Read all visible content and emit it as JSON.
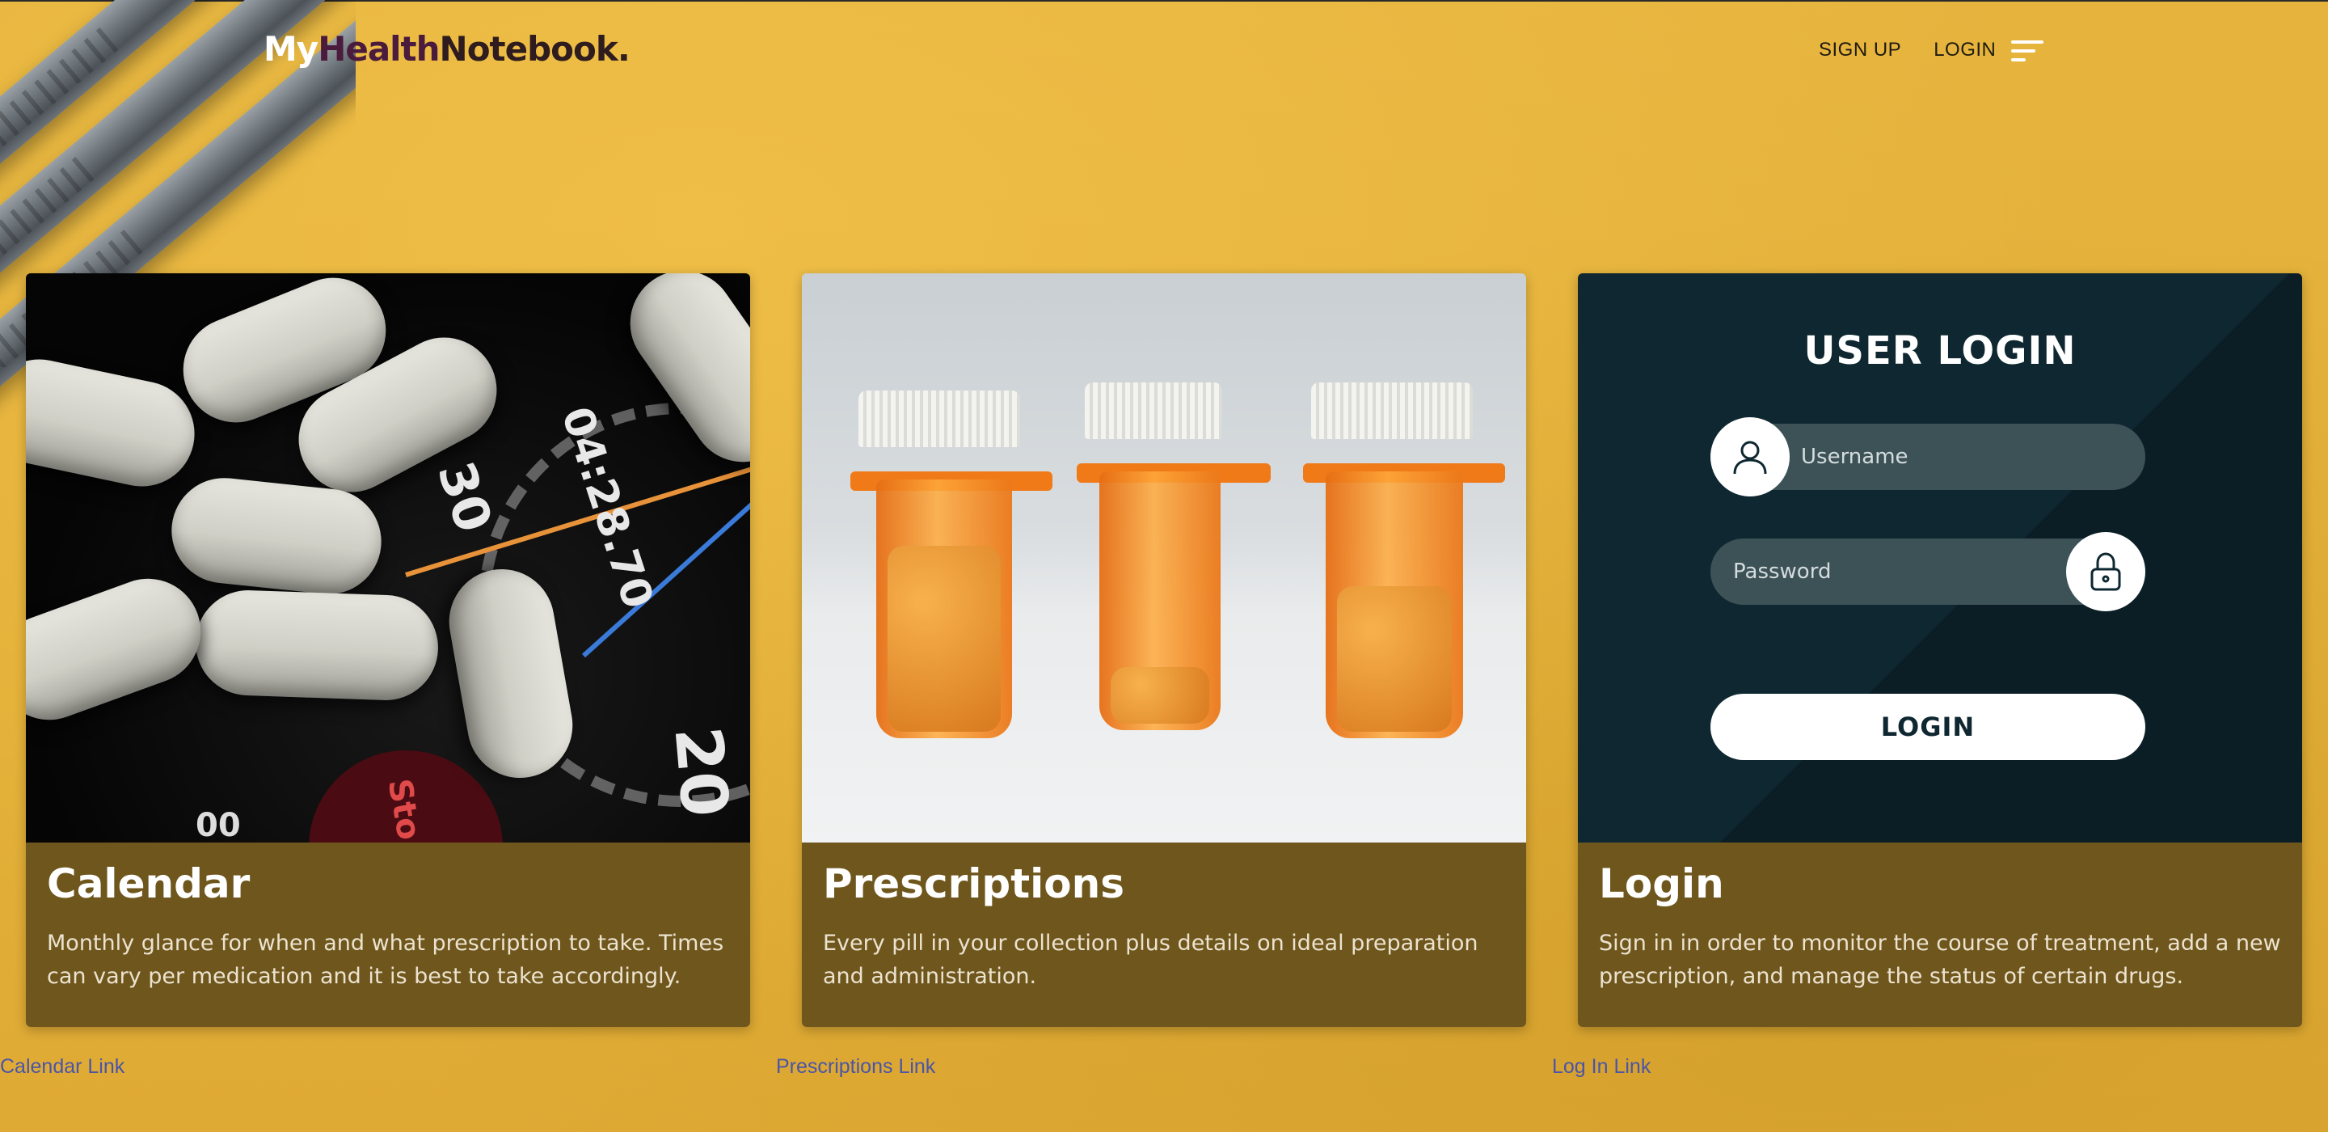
{
  "header": {
    "logo": {
      "my": "My",
      "health": "Health",
      "rest": "Notebook."
    },
    "nav": {
      "signup_label": "SIGN UP",
      "login_label": "LOGIN"
    },
    "menu_icon": "hamburger-menu-icon"
  },
  "cards": [
    {
      "title": "Calendar",
      "text": "Monthly glance for when and what prescription to take. Times can vary per medication and it is best to take accordingly.",
      "image": "pills-on-gauge-photo",
      "gauge_labels": [
        "30",
        "04:28.70",
        "20",
        "00",
        "Sto"
      ],
      "link": "Calendar Link"
    },
    {
      "title": "Prescriptions",
      "text": "Every pill in your collection plus details on ideal preparation and administration.",
      "image": "prescription-bottles-photo",
      "link": "Prescriptions Link"
    },
    {
      "title": "Login",
      "text": "Sign in in order to monitor the course of treatment, add a new prescription, and manage the status of certain drugs.",
      "link": "Log In Link"
    }
  ],
  "login_form": {
    "title": "USER LOGIN",
    "username_placeholder": "Username",
    "password_placeholder": "Password",
    "button_label": "LOGIN",
    "user_icon": "user-icon",
    "lock_icon": "lock-icon"
  },
  "colors": {
    "background": "#e4b23a",
    "card_body": "#6e561d",
    "login_panel": "#0e2730",
    "link": "#4a55a8"
  }
}
